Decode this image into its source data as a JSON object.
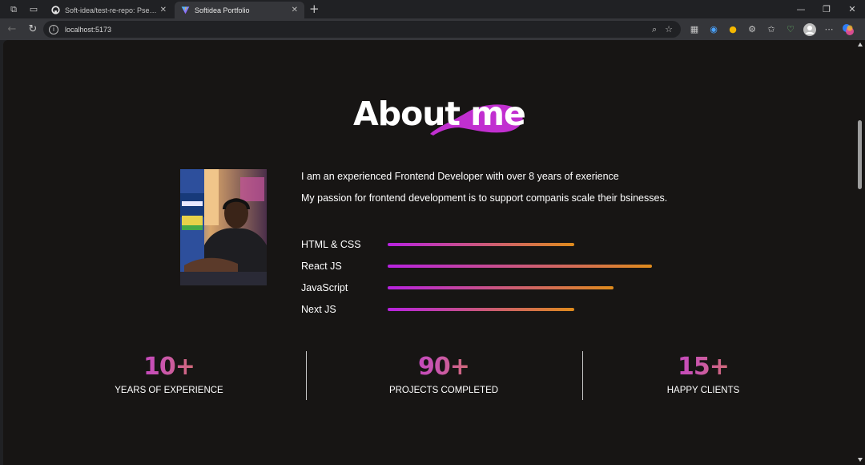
{
  "browser": {
    "tabs": [
      {
        "title": "Soft-idea/test-re-repo: Pseudo-p",
        "icon": "github-icon",
        "active": false
      },
      {
        "title": "Softidea Portfolio",
        "icon": "vite-icon",
        "active": true
      }
    ],
    "url": "localhost:5173"
  },
  "page": {
    "heading": "About me",
    "accent_colors": {
      "purple": "#b722e0",
      "orange": "#df8b1c",
      "blob": "#c12fd0"
    },
    "description": [
      "I am an experienced Frontend Developer with over 8 years of exerience",
      "My passion for frontend development is to support companis scale their bsinesses."
    ],
    "skills": [
      {
        "name": "HTML & CSS",
        "level": 0.53
      },
      {
        "name": "React JS",
        "level": 0.75
      },
      {
        "name": "JavaScript",
        "level": 0.64
      },
      {
        "name": "Next JS",
        "level": 0.53
      }
    ],
    "stats": [
      {
        "number": "10+",
        "label": "YEARS OF EXPERIENCE"
      },
      {
        "number": "90+",
        "label": "PROJECTS COMPLETED"
      },
      {
        "number": "15+",
        "label": "HAPPY CLIENTS"
      }
    ]
  }
}
